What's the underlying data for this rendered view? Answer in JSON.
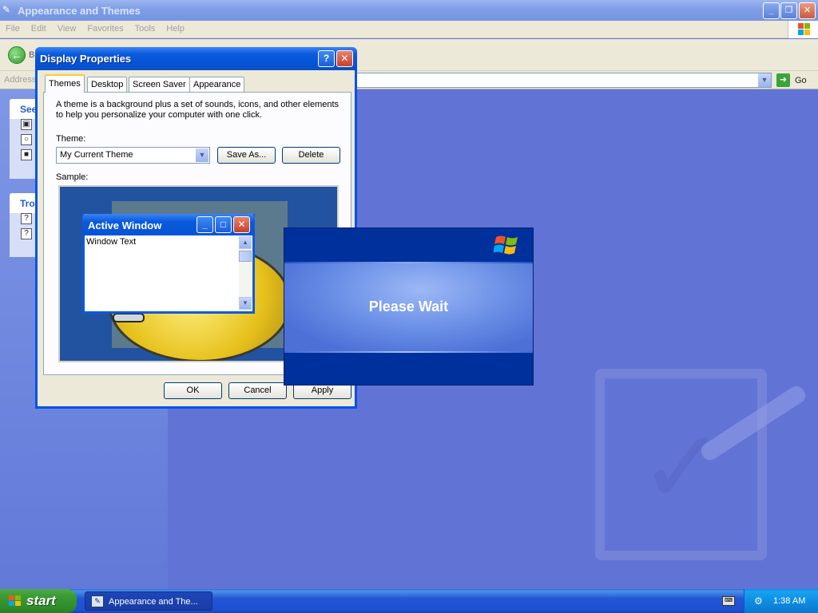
{
  "explorer": {
    "title": "Appearance and Themes",
    "menu": [
      "File",
      "Edit",
      "View",
      "Favorites",
      "Tools",
      "Help"
    ],
    "back_label": "B",
    "address_label": "Address",
    "go_label": "Go",
    "panel1_header": "See",
    "panel2_header": "Tro"
  },
  "dialog": {
    "title": "Display Properties",
    "tabs": [
      "Themes",
      "Desktop",
      "Screen Saver",
      "Appearance"
    ],
    "description": "A theme is a background plus a set of sounds, icons, and other elements to help you personalize your computer with one click.",
    "theme_label": "Theme:",
    "theme_value": "My Current Theme",
    "save_as_label": "Save As...",
    "delete_label": "Delete",
    "sample_label": "Sample:",
    "sample_window_title": "Active Window",
    "sample_window_text": "Window Text",
    "ok_label": "OK",
    "cancel_label": "Cancel",
    "apply_label": "Apply"
  },
  "splash": {
    "message": "Please Wait"
  },
  "taskbar": {
    "start_label": "start",
    "task_label": "Appearance and The...",
    "clock": "1:38 AM"
  }
}
